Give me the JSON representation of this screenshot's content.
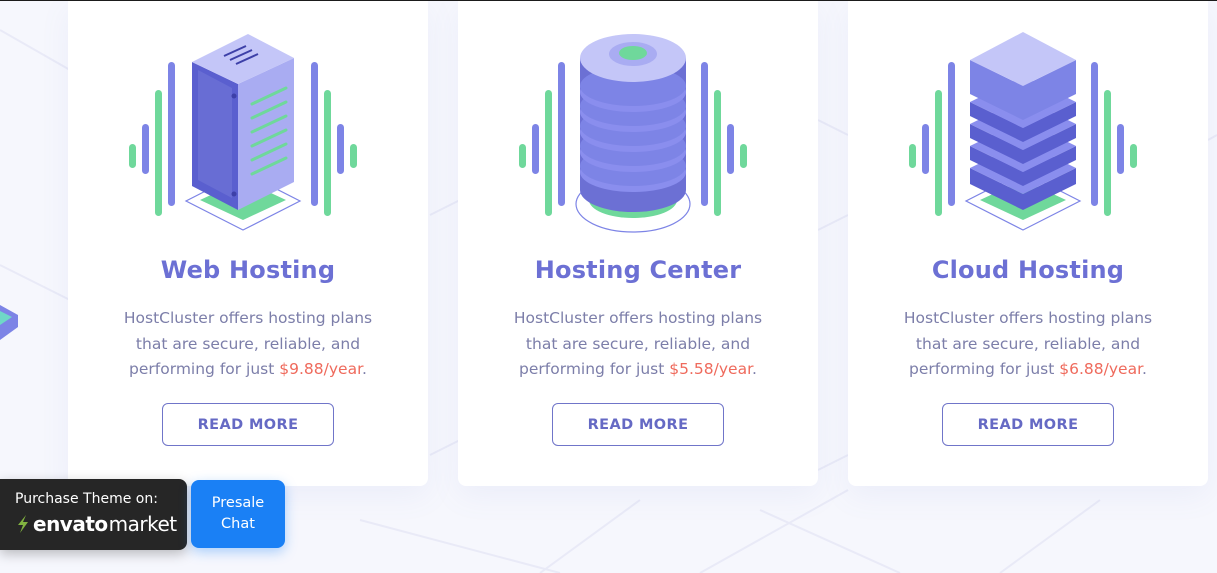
{
  "cards": [
    {
      "title": "Web Hosting",
      "desc_before": "HostCluster offers hosting plans that are secure, reliable, and performing for just ",
      "price": "$9.88/year",
      "desc_after": ".",
      "button": "READ MORE",
      "icon": "server-tower-icon"
    },
    {
      "title": "Hosting Center",
      "desc_before": "HostCluster offers hosting plans that are secure, reliable, and performing for just ",
      "price": "$5.58/year",
      "desc_after": ".",
      "button": "READ MORE",
      "icon": "database-cylinder-icon"
    },
    {
      "title": "Cloud Hosting",
      "desc_before": "HostCluster offers hosting plans that are secure, reliable, and performing for just ",
      "price": "$6.88/year",
      "desc_after": ".",
      "button": "READ MORE",
      "icon": "cloud-stack-icon"
    }
  ],
  "envato": {
    "label": "Purchase Theme on:",
    "brand": "envato",
    "market": "market"
  },
  "presale": {
    "line1": "Presale",
    "line2": "Chat"
  },
  "colors": {
    "accent": "#6c70d4",
    "price": "#ef6a5c",
    "green": "#6fd89b",
    "presale": "#1a80f5",
    "badge": "#262626"
  }
}
